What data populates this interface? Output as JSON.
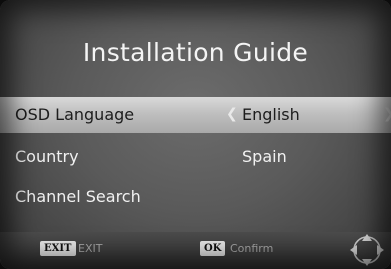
{
  "screen": {
    "title": "Installation Guide"
  },
  "menu": {
    "items": [
      {
        "label": "OSD Language",
        "value": "English"
      },
      {
        "label": "Country",
        "value": "Spain"
      },
      {
        "label": "Channel Search",
        "value": ""
      }
    ]
  },
  "footer": {
    "exit_key": "EXIT",
    "exit_text": "EXIT",
    "ok_key": "OK",
    "ok_text": "Confirm"
  },
  "icons": {
    "value_left_arrow": "chevron-left-icon",
    "value_right_arrow": "chevron-right-icon",
    "nav": "directional-pad-icon"
  }
}
